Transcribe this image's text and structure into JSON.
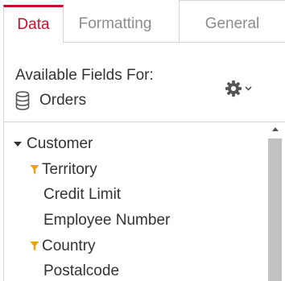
{
  "tabs": [
    {
      "label": "Data",
      "active": true
    },
    {
      "label": "Formatting",
      "active": false
    },
    {
      "label": "General",
      "active": false
    }
  ],
  "fields_panel": {
    "label": "Available Fields For:",
    "source_name": "Orders",
    "settings_icon": "gear-icon"
  },
  "tree": {
    "items": [
      {
        "label": "Customer",
        "icon": "caret-down-icon"
      },
      {
        "label": "Territory",
        "icon": "filter-icon"
      },
      {
        "label": "Credit Limit"
      },
      {
        "label": "Employee Number"
      },
      {
        "label": "Country",
        "icon": "filter-icon"
      },
      {
        "label": "Postalcode"
      }
    ]
  },
  "colors": {
    "accent": "#c8102e",
    "filter_icon": "#e8a317",
    "text": "#333333",
    "muted_tab": "#8c8c8c"
  }
}
